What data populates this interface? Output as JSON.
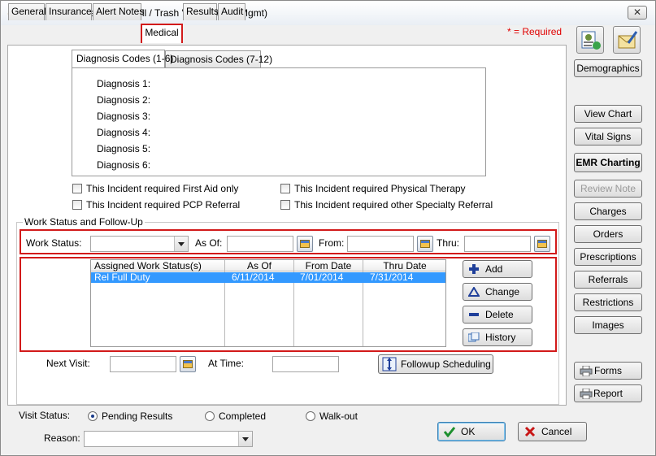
{
  "window": {
    "title": "Enter Patient Visit (Ben Adrill / Trash 'R' Us Waste Mgmt)",
    "close_label": "✕"
  },
  "tabs": [
    {
      "label": "General"
    },
    {
      "label": "Insurance"
    },
    {
      "label": "Alert Notes"
    },
    {
      "label": "Medical"
    },
    {
      "label": "Results"
    },
    {
      "label": "Audit"
    }
  ],
  "required_note": "* = Required",
  "diagnosis": {
    "tabs": [
      {
        "label": "Diagnosis Codes (1-6)"
      },
      {
        "label": "Diagnosis Codes (7-12)"
      }
    ],
    "labels": [
      "Diagnosis 1:",
      "Diagnosis 2:",
      "Diagnosis 3:",
      "Diagnosis 4:",
      "Diagnosis 5:",
      "Diagnosis 6:"
    ]
  },
  "checkboxes": [
    {
      "label": "This Incident required First Aid only"
    },
    {
      "label": "This Incident required PCP Referral"
    },
    {
      "label": "This Incident required Physical Therapy"
    },
    {
      "label": "This Incident required other Specialty Referral"
    }
  ],
  "work_status": {
    "group_title": "Work Status and Follow-Up",
    "work_status_label": "Work Status:",
    "as_of_label": "As Of:",
    "from_label": "From:",
    "thru_label": "Thru:",
    "list": {
      "columns": [
        "Assigned Work Status(s)",
        "As Of",
        "From Date",
        "Thru Date"
      ],
      "rows": [
        {
          "status": "Rel Full Duty",
          "as_of": "6/11/2014",
          "from": "7/01/2014",
          "thru": "7/31/2014"
        }
      ]
    },
    "buttons": {
      "add": "Add",
      "change": "Change",
      "delete": "Delete",
      "history": "History"
    },
    "next_visit_label": "Next Visit:",
    "at_time_label": "At Time:",
    "followup_button": "Followup Scheduling"
  },
  "visit_status": {
    "label": "Visit Status:",
    "options": [
      {
        "label": "Pending Results",
        "selected": true
      },
      {
        "label": "Completed"
      },
      {
        "label": "Walk-out"
      }
    ],
    "reason_label": "Reason:"
  },
  "footer": {
    "ok": "OK",
    "cancel": "Cancel"
  },
  "sidebar": {
    "demographics": "Demographics",
    "view_chart": "View Chart",
    "vital_signs": "Vital Signs",
    "emr_charting": "EMR Charting",
    "review_note": "Review Note",
    "charges": "Charges",
    "orders": "Orders",
    "prescriptions": "Prescriptions",
    "referrals": "Referrals",
    "restrictions": "Restrictions",
    "images": "Images",
    "forms": "Forms",
    "report": "Report"
  },
  "colors": {
    "highlight_red": "#d21a1a",
    "selection_blue": "#3399ff",
    "required_red": "#e00000"
  }
}
